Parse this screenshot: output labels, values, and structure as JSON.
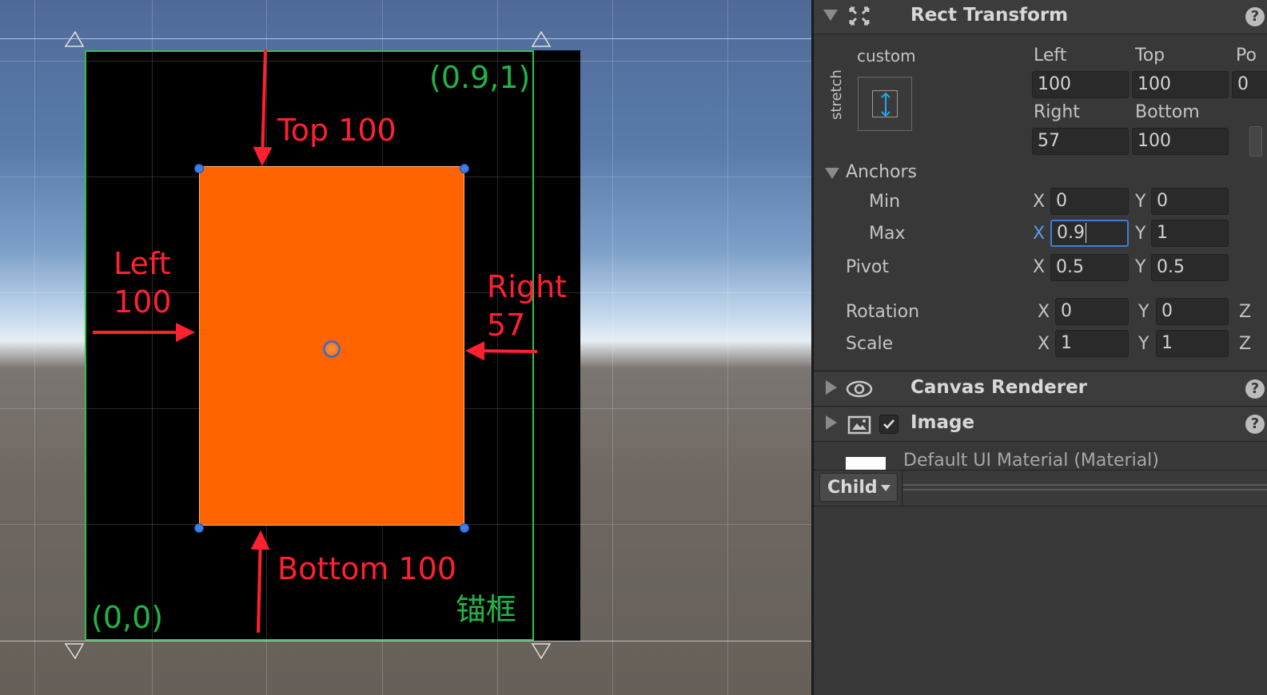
{
  "scene": {
    "labels": {
      "top": "Top 100",
      "left": "Left\n100",
      "right": "Right\n57",
      "bottom": "Bottom 100",
      "anchor_max": "(0.9,1)",
      "anchor_min": "(0,0)",
      "anchor_frame": "锚框"
    },
    "colors": {
      "annotation": "#ff2030",
      "anchor": "#1fb548",
      "image": "#ff6400"
    }
  },
  "inspector": {
    "rect_transform": {
      "title": "Rect Transform",
      "preset_label": "custom",
      "preset_side_label": "stretch",
      "left_label": "Left",
      "top_label": "Top",
      "pos_label": "Po",
      "right_label": "Right",
      "bottom_label": "Bottom",
      "left": "100",
      "top": "100",
      "pos_z": "0",
      "right": "57",
      "bottom": "100",
      "anchors_label": "Anchors",
      "min_label": "Min",
      "max_label": "Max",
      "min_x": "0",
      "min_y": "0",
      "max_x": "0.9",
      "max_y": "1",
      "pivot_label": "Pivot",
      "pivot_x": "0.5",
      "pivot_y": "0.5",
      "rotation_label": "Rotation",
      "rot_x": "0",
      "rot_y": "0",
      "scale_label": "Scale",
      "scale_x": "1",
      "scale_y": "1",
      "x": "X",
      "y": "Y",
      "z": "Z"
    },
    "canvas_renderer": {
      "title": "Canvas Renderer"
    },
    "image": {
      "title": "Image",
      "enabled": true
    },
    "material": {
      "name": "Default UI Material (Material)"
    },
    "child_dropdown": {
      "label": "Child"
    }
  }
}
